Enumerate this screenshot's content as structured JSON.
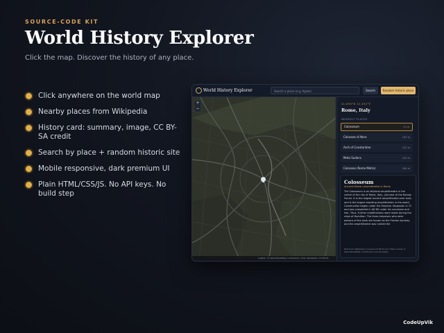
{
  "promo": {
    "eyebrow": "SOURCE-CODE KIT",
    "title": "World History Explorer",
    "subtitle": "Click the map. Discover the history of any place.",
    "features": [
      "Click anywhere on the world map",
      "Nearby places from Wikipedia",
      "History card: summary, image, CC BY-SA credit",
      "Search by place + random historic site",
      "Mobile responsive, dark premium UI",
      "Plain HTML/CSS/JS. No API keys. No build step"
    ],
    "brand": "CodeUpVik"
  },
  "app": {
    "title": "World History Explorer",
    "search_placeholder": "Search a place (e.g. Kyoto)",
    "search_button": "Search",
    "random_button": "Random historic place",
    "map": {
      "zoom_in": "+",
      "zoom_out": "−",
      "attribution": "Leaflet | © OpenStreetMap contributors, Tiles: Wikipedia | CC BY-SA"
    },
    "panel": {
      "coords": "41.890°N 12.492°E",
      "place": "Rome, Italy",
      "nearby_heading": "NEAREST PLACES",
      "nearby": [
        {
          "name": "Colosseum",
          "distance": "11 m"
        },
        {
          "name": "Colosseo di Nero",
          "distance": "103 m"
        },
        {
          "name": "Arch of Constantine",
          "distance": "122 m"
        },
        {
          "name": "Meta Sudans",
          "distance": "129 m"
        },
        {
          "name": "Colosseo (Rome Metro)",
          "distance": "160 m"
        }
      ],
      "card": {
        "title": "Colosseum",
        "subtitle": "Ancient Roman amphitheatre in Rome",
        "summary": "The Colosseum is an elliptical amphitheatre in the centre of the city of Rome, Italy, just east of the Roman Forum. It is the largest ancient amphitheatre ever built, and is the largest standing amphitheatre in the world. Construction began under the Emperor Vespasian in 72 and was completed in AD 80 under his successor and heir, Titus. Further modifications were made during the reign of Domitian. The three emperors who were patrons of the work are known as the Flavian dynasty, and the amphitheatre was named the",
        "source": "Text from Wikipedia, licensed CC BY-SA 4.0. Place names © OpenStreetMap contributors (coordinates)."
      }
    }
  },
  "colors": {
    "accent": "#d9a35c",
    "button": "#e3b76e",
    "background": "#0f131b"
  }
}
